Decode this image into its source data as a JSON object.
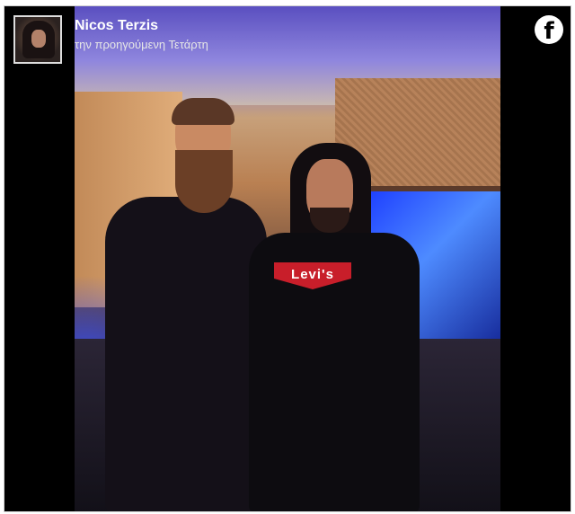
{
  "post": {
    "author": "Nicos Terzis",
    "timestamp": "την προηγούμενη Τετάρτη",
    "shirt_text": "Levi's"
  },
  "icons": {
    "platform": "facebook-icon",
    "platform_glyph": "f"
  },
  "colors": {
    "frame_background": "#000000",
    "text": "#ffffff"
  }
}
